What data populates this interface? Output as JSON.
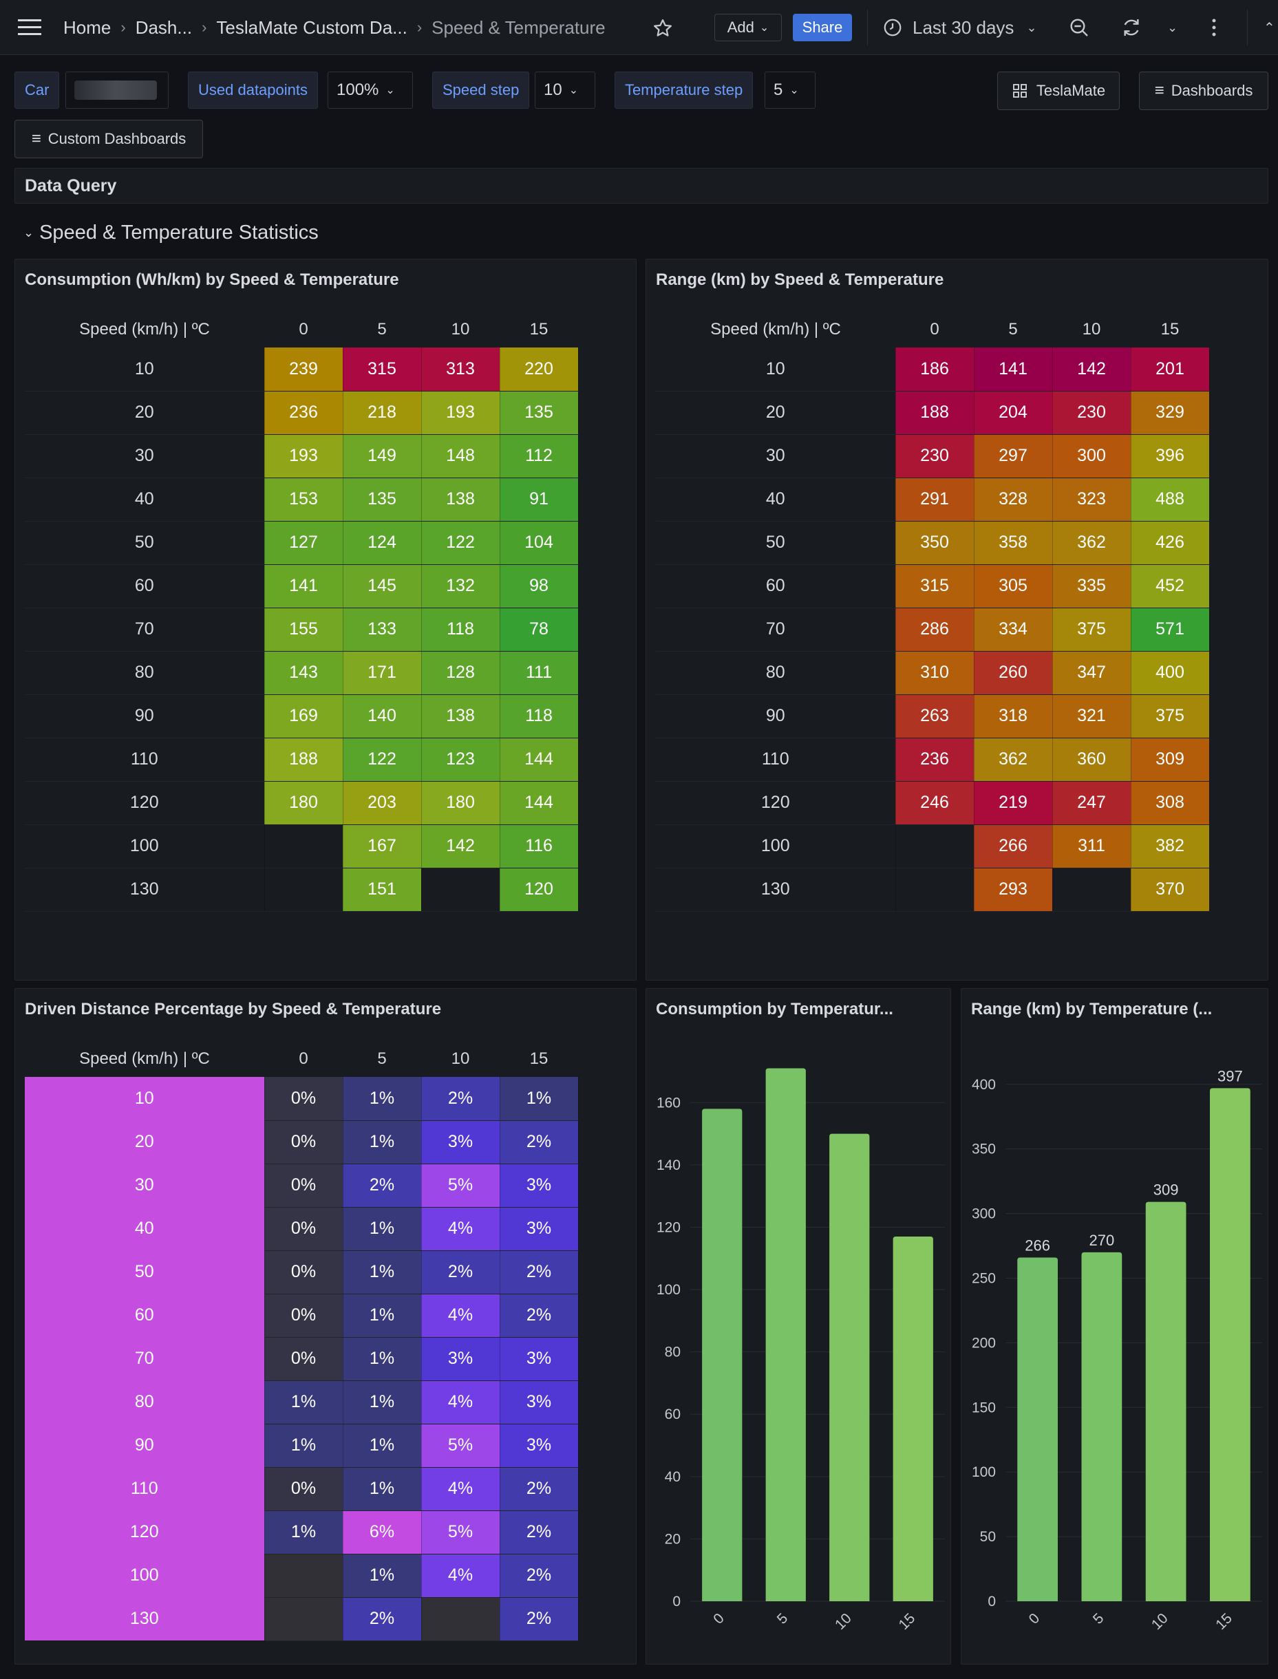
{
  "topbar": {
    "breadcrumb": [
      "Home",
      "Dash...",
      "TeslaMate Custom Da...",
      "Speed & Temperature"
    ],
    "add_label": "Add",
    "share_label": "Share",
    "time_range": "Last 30 days"
  },
  "variables": {
    "car_label": "Car",
    "car_value": "",
    "datapoints_label": "Used datapoints",
    "datapoints_value": "100%",
    "speed_step_label": "Speed step",
    "speed_step_value": "10",
    "temp_step_label": "Temperature step",
    "temp_step_value": "5",
    "teslamate_link": "TeslaMate",
    "dashboards_link": "Dashboards",
    "custom_dashboards_link": "Custom Dashboards"
  },
  "rows": {
    "data_query": "Data Query",
    "stats": "Speed & Temperature Statistics"
  },
  "colors": {
    "background": "#111217",
    "panel": "#181b1f",
    "share_button": "#3d71d9",
    "bar_green": "#73bf69"
  },
  "table_header": {
    "corner": "Speed (km/h) | ºC",
    "temps": [
      "0",
      "5",
      "10",
      "15"
    ]
  },
  "consumption_table": {
    "title": "Consumption (Wh/km) by Speed & Temperature",
    "rows": [
      {
        "speed": "10",
        "cells": [
          "239",
          "315",
          "313",
          "220"
        ]
      },
      {
        "speed": "20",
        "cells": [
          "236",
          "218",
          "193",
          "135"
        ]
      },
      {
        "speed": "30",
        "cells": [
          "193",
          "149",
          "148",
          "112"
        ]
      },
      {
        "speed": "40",
        "cells": [
          "153",
          "135",
          "138",
          "91"
        ]
      },
      {
        "speed": "50",
        "cells": [
          "127",
          "124",
          "122",
          "104"
        ]
      },
      {
        "speed": "60",
        "cells": [
          "141",
          "145",
          "132",
          "98"
        ]
      },
      {
        "speed": "70",
        "cells": [
          "155",
          "133",
          "118",
          "78"
        ]
      },
      {
        "speed": "80",
        "cells": [
          "143",
          "171",
          "128",
          "111"
        ]
      },
      {
        "speed": "90",
        "cells": [
          "169",
          "140",
          "138",
          "118"
        ]
      },
      {
        "speed": "110",
        "cells": [
          "188",
          "122",
          "123",
          "144"
        ]
      },
      {
        "speed": "120",
        "cells": [
          "180",
          "203",
          "180",
          "144"
        ]
      },
      {
        "speed": "100",
        "cells": [
          "",
          "167",
          "142",
          "116"
        ]
      },
      {
        "speed": "130",
        "cells": [
          "",
          "151",
          "",
          "120"
        ]
      }
    ]
  },
  "range_table": {
    "title": "Range (km) by Speed & Temperature",
    "rows": [
      {
        "speed": "10",
        "cells": [
          "186",
          "141",
          "142",
          "201"
        ]
      },
      {
        "speed": "20",
        "cells": [
          "188",
          "204",
          "230",
          "329"
        ]
      },
      {
        "speed": "30",
        "cells": [
          "230",
          "297",
          "300",
          "396"
        ]
      },
      {
        "speed": "40",
        "cells": [
          "291",
          "328",
          "323",
          "488"
        ]
      },
      {
        "speed": "50",
        "cells": [
          "350",
          "358",
          "362",
          "426"
        ]
      },
      {
        "speed": "60",
        "cells": [
          "315",
          "305",
          "335",
          "452"
        ]
      },
      {
        "speed": "70",
        "cells": [
          "286",
          "334",
          "375",
          "571"
        ]
      },
      {
        "speed": "80",
        "cells": [
          "310",
          "260",
          "347",
          "400"
        ]
      },
      {
        "speed": "90",
        "cells": [
          "263",
          "318",
          "321",
          "375"
        ]
      },
      {
        "speed": "110",
        "cells": [
          "236",
          "362",
          "360",
          "309"
        ]
      },
      {
        "speed": "120",
        "cells": [
          "246",
          "219",
          "247",
          "308"
        ]
      },
      {
        "speed": "100",
        "cells": [
          "",
          "266",
          "311",
          "382"
        ]
      },
      {
        "speed": "130",
        "cells": [
          "",
          "293",
          "",
          "370"
        ]
      }
    ]
  },
  "distance_table": {
    "title": "Driven Distance Percentage by Speed & Temperature",
    "rows": [
      {
        "speed": "10",
        "cells": [
          "0%",
          "1%",
          "2%",
          "1%"
        ]
      },
      {
        "speed": "20",
        "cells": [
          "0%",
          "1%",
          "3%",
          "2%"
        ]
      },
      {
        "speed": "30",
        "cells": [
          "0%",
          "2%",
          "5%",
          "3%"
        ]
      },
      {
        "speed": "40",
        "cells": [
          "0%",
          "1%",
          "4%",
          "3%"
        ]
      },
      {
        "speed": "50",
        "cells": [
          "0%",
          "1%",
          "2%",
          "2%"
        ]
      },
      {
        "speed": "60",
        "cells": [
          "0%",
          "1%",
          "4%",
          "2%"
        ]
      },
      {
        "speed": "70",
        "cells": [
          "0%",
          "1%",
          "3%",
          "3%"
        ]
      },
      {
        "speed": "80",
        "cells": [
          "1%",
          "1%",
          "4%",
          "3%"
        ]
      },
      {
        "speed": "90",
        "cells": [
          "1%",
          "1%",
          "5%",
          "3%"
        ]
      },
      {
        "speed": "110",
        "cells": [
          "0%",
          "1%",
          "4%",
          "2%"
        ]
      },
      {
        "speed": "120",
        "cells": [
          "1%",
          "6%",
          "5%",
          "2%"
        ]
      },
      {
        "speed": "100",
        "cells": [
          "",
          "1%",
          "4%",
          "2%"
        ]
      },
      {
        "speed": "130",
        "cells": [
          "",
          "2%",
          "",
          "2%"
        ]
      }
    ]
  },
  "chart_data": [
    {
      "type": "bar",
      "title": "Consumption by Temperatur...",
      "categories": [
        "0",
        "5",
        "10",
        "15"
      ],
      "values": [
        158,
        171,
        150,
        117
      ],
      "ylim": [
        0,
        170
      ],
      "yticks": [
        0,
        20,
        40,
        60,
        80,
        100,
        120,
        140,
        160
      ],
      "show_value_labels": false,
      "grid": true
    },
    {
      "type": "bar",
      "title": "Range (km) by Temperature (...",
      "categories": [
        "0",
        "5",
        "10",
        "15"
      ],
      "values": [
        266,
        270,
        309,
        397
      ],
      "ylim": [
        0,
        410
      ],
      "yticks": [
        0,
        50,
        100,
        150,
        200,
        250,
        300,
        350,
        400
      ],
      "show_value_labels": true,
      "grid": true
    }
  ]
}
